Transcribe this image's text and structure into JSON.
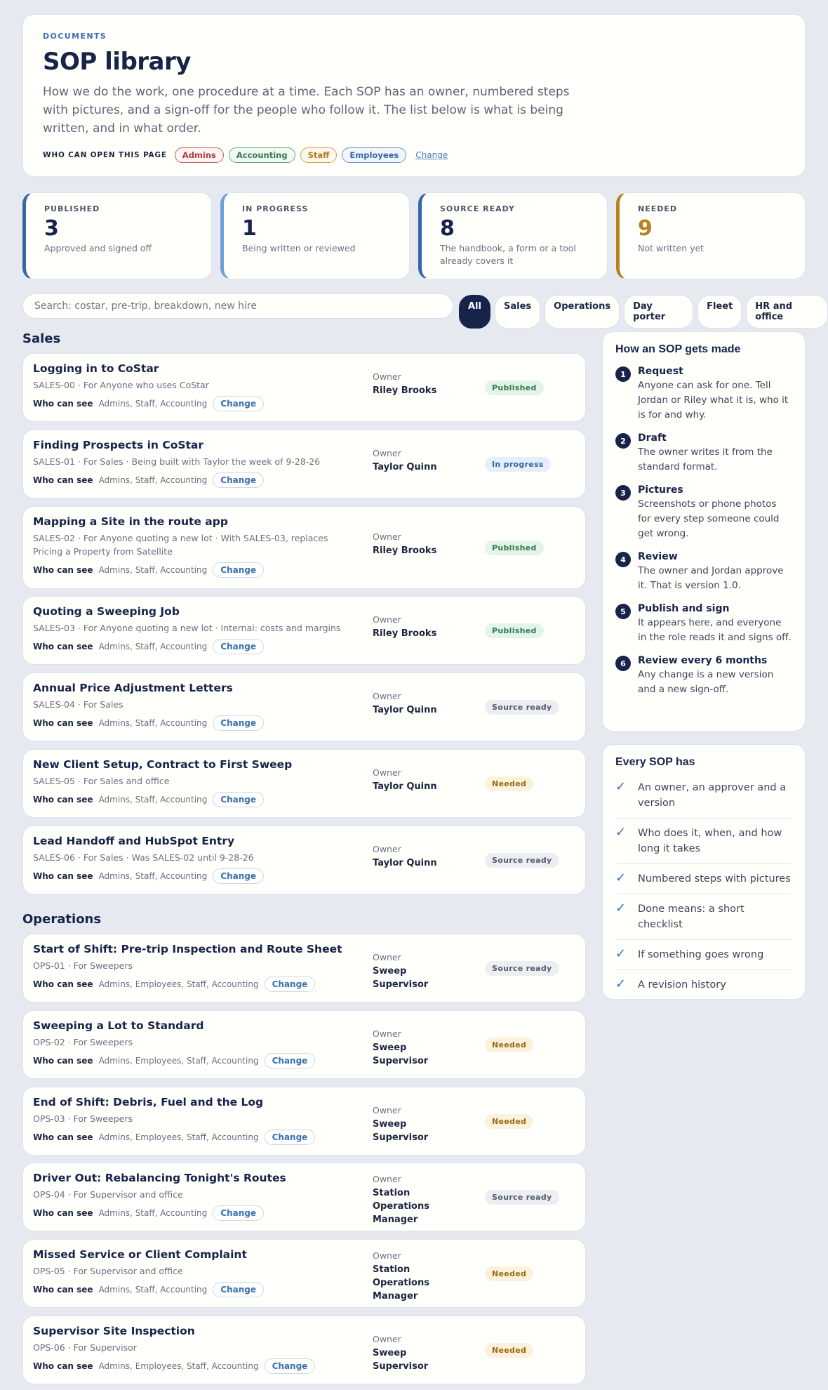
{
  "header": {
    "eyebrow": "DOCUMENTS",
    "title": "SOP library",
    "intro": "How we do the work, one procedure at a time. Each SOP has an owner, numbered steps with pictures, and a sign-off for the people who follow it. The list below is what is being written, and in what order.",
    "access_label": "WHO CAN OPEN THIS PAGE",
    "roles": [
      "Admins",
      "Accounting",
      "Staff",
      "Employees"
    ],
    "change_label": "Change"
  },
  "stats": [
    {
      "label": "PUBLISHED",
      "value": "3",
      "desc": "Approved and signed off",
      "color": "#3467a8"
    },
    {
      "label": "IN PROGRESS",
      "value": "1",
      "desc": "Being written or reviewed",
      "color": "#6fa0d8"
    },
    {
      "label": "SOURCE READY",
      "value": "8",
      "desc": "The handbook, a form or a tool already covers it",
      "color": "#3467a8"
    },
    {
      "label": "NEEDED",
      "value": "9",
      "desc": "Not written yet",
      "color": "#b8801e"
    }
  ],
  "search": {
    "placeholder": "Search: costar, pre-trip, breakdown, new hire"
  },
  "filters": [
    "All",
    "Sales",
    "Operations",
    "Day porter",
    "Fleet",
    "HR and office"
  ],
  "list": {
    "see_label": "Who can see",
    "owner_label": "Owner",
    "change_label": "Change"
  },
  "sections": [
    {
      "title": "Sales",
      "items": [
        {
          "title": "Logging in to CoStar",
          "meta": "SALES-00 · For Anyone who uses CoStar",
          "roles": "Admins, Staff, Accounting",
          "owner": "Riley Brooks",
          "status": "Published"
        },
        {
          "title": "Finding Prospects in CoStar",
          "meta": "SALES-01 · For Sales · Being built with Taylor the week of 9-28-26",
          "roles": "Admins, Staff, Accounting",
          "owner": "Taylor Quinn",
          "status": "In progress"
        },
        {
          "title": "Mapping a Site in the route app",
          "meta": "SALES-02 · For Anyone quoting a new lot · With SALES-03, replaces Pricing a Property from Satellite",
          "roles": "Admins, Staff, Accounting",
          "owner": "Riley Brooks",
          "status": "Published"
        },
        {
          "title": "Quoting a Sweeping Job",
          "meta": "SALES-03 · For Anyone quoting a new lot · Internal: costs and margins",
          "roles": "Admins, Staff, Accounting",
          "owner": "Riley Brooks",
          "status": "Published"
        },
        {
          "title": "Annual Price Adjustment Letters",
          "meta": "SALES-04 · For Sales",
          "roles": "Admins, Staff, Accounting",
          "owner": "Taylor Quinn",
          "status": "Source ready"
        },
        {
          "title": "New Client Setup, Contract to First Sweep",
          "meta": "SALES-05 · For Sales and office",
          "roles": "Admins, Staff, Accounting",
          "owner": "Taylor Quinn",
          "status": "Needed"
        },
        {
          "title": "Lead Handoff and HubSpot Entry",
          "meta": "SALES-06 · For Sales · Was SALES-02 until 9-28-26",
          "roles": "Admins, Staff, Accounting",
          "owner": "Taylor Quinn",
          "status": "Source ready"
        }
      ]
    },
    {
      "title": "Operations",
      "items": [
        {
          "title": "Start of Shift: Pre-trip Inspection and Route Sheet",
          "meta": "OPS-01 · For Sweepers",
          "roles": "Admins, Employees, Staff, Accounting",
          "owner": "Sweep Supervisor",
          "status": "Source ready"
        },
        {
          "title": "Sweeping a Lot to Standard",
          "meta": "OPS-02 · For Sweepers",
          "roles": "Admins, Employees, Staff, Accounting",
          "owner": "Sweep Supervisor",
          "status": "Needed"
        },
        {
          "title": "End of Shift: Debris, Fuel and the Log",
          "meta": "OPS-03 · For Sweepers",
          "roles": "Admins, Employees, Staff, Accounting",
          "owner": "Sweep Supervisor",
          "status": "Needed"
        },
        {
          "title": "Driver Out: Rebalancing Tonight's Routes",
          "meta": "OPS-04 · For Supervisor and office",
          "roles": "Admins, Staff, Accounting",
          "owner": "Station Operations Manager",
          "status": "Source ready"
        },
        {
          "title": "Missed Service or Client Complaint",
          "meta": "OPS-05 · For Supervisor and office",
          "roles": "Admins, Staff, Accounting",
          "owner": "Station Operations Manager",
          "status": "Needed"
        },
        {
          "title": "Supervisor Site Inspection",
          "meta": "OPS-06 · For Supervisor",
          "roles": "Admins, Employees, Staff, Accounting",
          "owner": "Sweep Supervisor",
          "status": "Needed"
        }
      ]
    }
  ],
  "how_made": {
    "title": "How an SOP gets made",
    "steps": [
      {
        "num": "1",
        "title": "Request",
        "desc": "Anyone can ask for one. Tell Jordan or Riley what it is, who it is for and why."
      },
      {
        "num": "2",
        "title": "Draft",
        "desc": "The owner writes it from the standard format."
      },
      {
        "num": "3",
        "title": "Pictures",
        "desc": "Screenshots or phone photos for every step someone could get wrong."
      },
      {
        "num": "4",
        "title": "Review",
        "desc": "The owner and Jordan approve it. That is version 1.0."
      },
      {
        "num": "5",
        "title": "Publish and sign",
        "desc": "It appears here, and everyone in the role reads it and signs off."
      },
      {
        "num": "6",
        "title": "Review every 6 months",
        "desc": "Any change is a new version and a new sign-off."
      }
    ]
  },
  "every_sop": {
    "title": "Every SOP has",
    "items": [
      "An owner, an approver and a version",
      "Who does it, when, and how long it takes",
      "Numbered steps with pictures",
      "Done means: a short checklist",
      "If something goes wrong",
      "A revision history"
    ]
  },
  "icons": {
    "check": "check-icon"
  }
}
